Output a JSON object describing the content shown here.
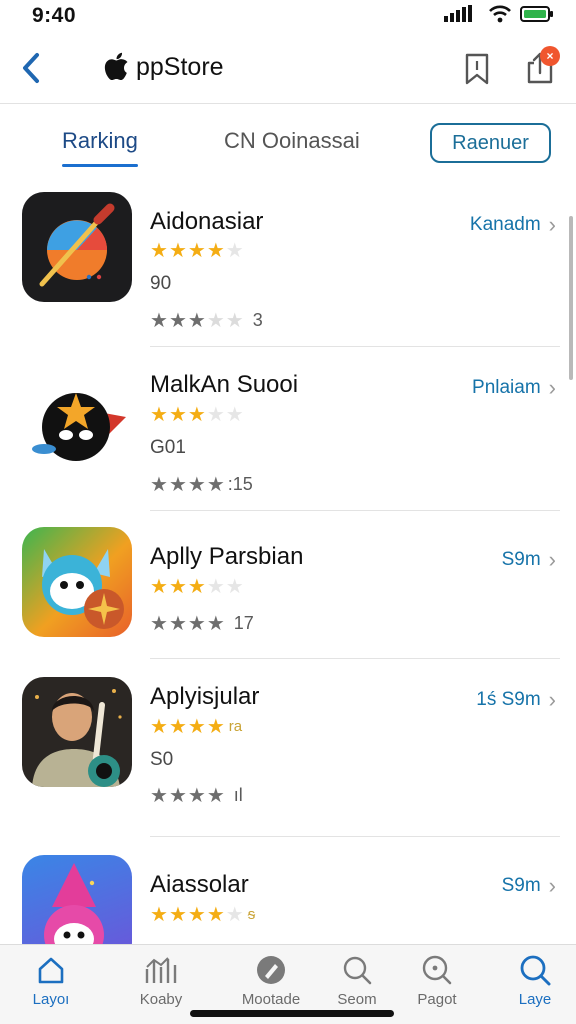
{
  "status_bar": {
    "time": "9:40"
  },
  "nav": {
    "title": "ppStore",
    "badge": "×"
  },
  "tabs": {
    "active": "Rarking",
    "second": "CN Ooinassai",
    "pill": "Raenuer"
  },
  "apps": [
    {
      "name": "Aidonasiar",
      "stars": 4,
      "sub": "90",
      "rating_stars": 3,
      "rating_count": "3",
      "action": "Kanadm"
    },
    {
      "name": "MalkAn Suooi",
      "stars": 3,
      "sub": "G01",
      "rating_stars": 4,
      "rating_count": ":15",
      "action": "Pnlaiam"
    },
    {
      "name": "Aplly Parsbian",
      "stars": 3,
      "sub": "",
      "rating_stars": 4,
      "rating_count": "17",
      "action": "S9m"
    },
    {
      "name": "Aplyisjular",
      "stars": 4,
      "stars_extra": "ra",
      "sub": "S0",
      "rating_stars": 4,
      "rating_count": "ıl",
      "action": "1ś S9m"
    },
    {
      "name": "Aiassolar",
      "stars": 4,
      "stars_extra": "ᵴ",
      "sub": "",
      "rating_stars": 0,
      "rating_count": "",
      "action": "S9m"
    }
  ],
  "tab_bar": {
    "items": [
      {
        "label": "Layoı",
        "icon": "home-icon"
      },
      {
        "label": "Koaby",
        "icon": "charts-icon"
      },
      {
        "label": "Mootade",
        "icon": "edit-circle-icon"
      },
      {
        "label": "Seom",
        "icon": "search-icon"
      },
      {
        "label": "Pagot",
        "icon": "search-circle-icon"
      },
      {
        "label": "Laye",
        "icon": "search-icon"
      }
    ]
  },
  "colors": {
    "accent": "#1b6fcf",
    "star": "#f4ad14",
    "link": "#1673a9"
  }
}
